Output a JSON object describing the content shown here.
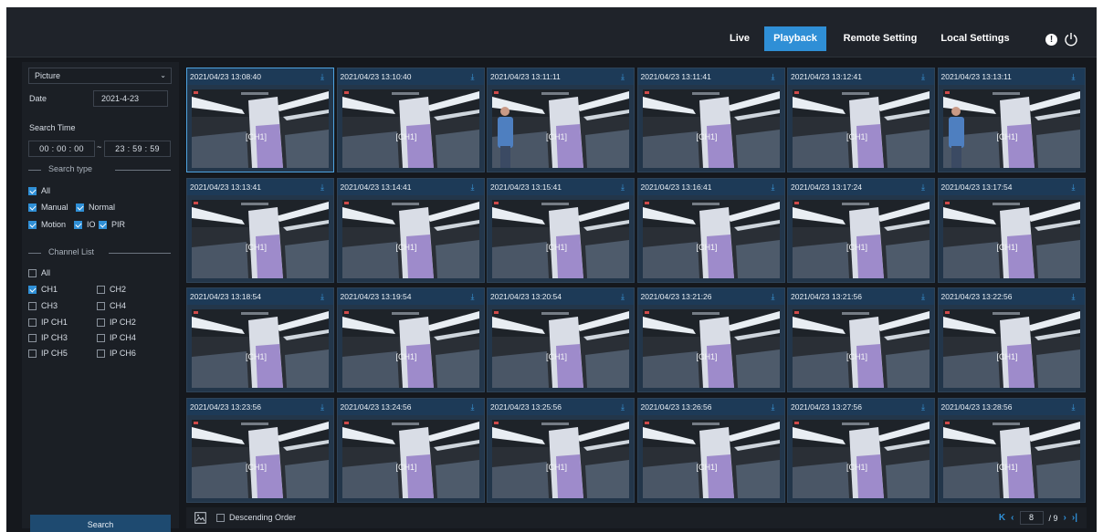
{
  "nav": {
    "tabs": [
      {
        "label": "Live",
        "active": false
      },
      {
        "label": "Playback",
        "active": true
      },
      {
        "label": "Remote Setting",
        "active": false
      },
      {
        "label": "Local Settings",
        "active": false
      }
    ],
    "icons": [
      "alert-icon",
      "power-icon"
    ]
  },
  "sidebar": {
    "mode_select": "Picture",
    "date_label": "Date",
    "date_value": "2021-4-23",
    "search_time_label": "Search Time",
    "time_start": "00 : 00 : 00",
    "time_sep": "~",
    "time_end": "23 : 59 : 59",
    "search_type_title": "Search type",
    "search_types": [
      {
        "label": "All",
        "checked": true
      },
      {
        "label": "Manual",
        "checked": true
      },
      {
        "label": "Normal",
        "checked": true
      },
      {
        "label": "Motion",
        "checked": true
      },
      {
        "label": "IO",
        "checked": true
      },
      {
        "label": "PIR",
        "checked": true
      }
    ],
    "channel_list_title": "Channel List",
    "channels": [
      {
        "label": "All",
        "checked": false
      },
      {
        "label": "CH1",
        "checked": true
      },
      {
        "label": "CH2",
        "checked": false
      },
      {
        "label": "CH3",
        "checked": false
      },
      {
        "label": "CH4",
        "checked": false
      },
      {
        "label": "IP CH1",
        "checked": false
      },
      {
        "label": "IP CH2",
        "checked": false
      },
      {
        "label": "IP CH3",
        "checked": false
      },
      {
        "label": "IP CH4",
        "checked": false
      },
      {
        "label": "IP CH5",
        "checked": false
      },
      {
        "label": "IP CH6",
        "checked": false
      }
    ],
    "search_button": "Search"
  },
  "grid": {
    "channel_label": "[CH1]",
    "cells": [
      "2021/04/23 13:08:40",
      "2021/04/23 13:10:40",
      "2021/04/23 13:11:11",
      "2021/04/23 13:11:41",
      "2021/04/23 13:12:41",
      "2021/04/23 13:13:11",
      "2021/04/23 13:13:41",
      "2021/04/23 13:14:41",
      "2021/04/23 13:15:41",
      "2021/04/23 13:16:41",
      "2021/04/23 13:17:24",
      "2021/04/23 13:17:54",
      "2021/04/23 13:18:54",
      "2021/04/23 13:19:54",
      "2021/04/23 13:20:54",
      "2021/04/23 13:21:26",
      "2021/04/23 13:21:56",
      "2021/04/23 13:22:56",
      "2021/04/23 13:23:56",
      "2021/04/23 13:24:56",
      "2021/04/23 13:25:56",
      "2021/04/23 13:26:56",
      "2021/04/23 13:27:56",
      "2021/04/23 13:28:56"
    ],
    "selected_index": 0,
    "person_visible": [
      false,
      false,
      true,
      false,
      false,
      true
    ]
  },
  "footer": {
    "descending_order_label": "Descending Order",
    "descending_checked": false,
    "current_page": "8",
    "total_pages": "/ 9"
  },
  "colors": {
    "accent": "#2f8fd6",
    "header_bg": "#1f232a",
    "cell_head": "#1d3a57"
  }
}
